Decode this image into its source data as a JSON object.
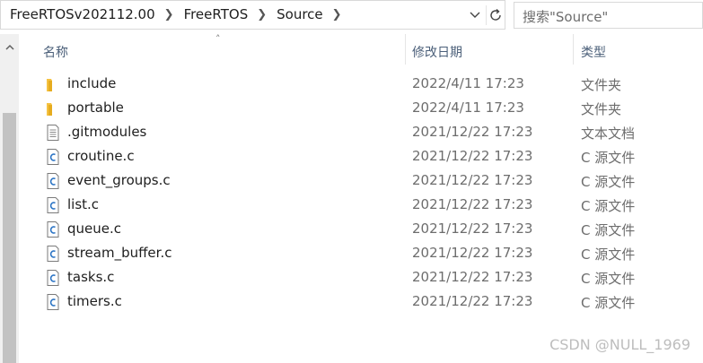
{
  "address_bar": {
    "crumbs": [
      "FreeRTOSv202112.00",
      "FreeRTOS",
      "Source"
    ],
    "dropdown_icon": "chevron-down-icon",
    "refresh_icon": "refresh-icon"
  },
  "search": {
    "placeholder": "搜索\"Source\""
  },
  "columns": {
    "name": "名称",
    "date": "修改日期",
    "type": "类型"
  },
  "files": [
    {
      "name": "include",
      "date": "2022/4/11 17:23",
      "type": "文件夹",
      "icon": "folder-icon"
    },
    {
      "name": "portable",
      "date": "2022/4/11 17:23",
      "type": "文件夹",
      "icon": "folder-icon"
    },
    {
      "name": ".gitmodules",
      "date": "2021/12/22 17:23",
      "type": "文本文档",
      "icon": "text-file-icon"
    },
    {
      "name": "croutine.c",
      "date": "2021/12/22 17:23",
      "type": "C 源文件",
      "icon": "c-file-icon"
    },
    {
      "name": "event_groups.c",
      "date": "2021/12/22 17:23",
      "type": "C 源文件",
      "icon": "c-file-icon"
    },
    {
      "name": "list.c",
      "date": "2021/12/22 17:23",
      "type": "C 源文件",
      "icon": "c-file-icon"
    },
    {
      "name": "queue.c",
      "date": "2021/12/22 17:23",
      "type": "C 源文件",
      "icon": "c-file-icon"
    },
    {
      "name": "stream_buffer.c",
      "date": "2021/12/22 17:23",
      "type": "C 源文件",
      "icon": "c-file-icon"
    },
    {
      "name": "tasks.c",
      "date": "2021/12/22 17:23",
      "type": "C 源文件",
      "icon": "c-file-icon"
    },
    {
      "name": "timers.c",
      "date": "2021/12/22 17:23",
      "type": "C 源文件",
      "icon": "c-file-icon"
    }
  ],
  "watermark": "CSDN @NULL_1969",
  "colors": {
    "folder": "#f5c242",
    "c_icon": "#2a73c4",
    "header_text": "#4c607a"
  }
}
